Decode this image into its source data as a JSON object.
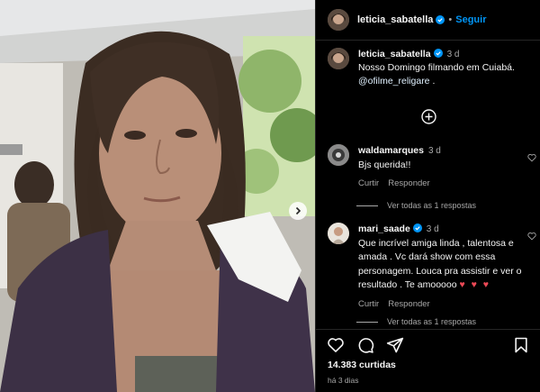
{
  "post": {
    "author": "leticia_sabatella",
    "follow_label": "Seguir",
    "separator": "•",
    "caption_author": "leticia_sabatella",
    "caption_time": "3 d",
    "caption_text": "Nosso Domingo filmando em Cuiabá.",
    "caption_mention": "@ofilme_religare",
    "caption_end": " ."
  },
  "comments": [
    {
      "user": "waldamarques",
      "time": "3 d",
      "text": "Bjs querida!!",
      "reply_label": "Curtir",
      "respond_label": "Responder",
      "view_replies": "Ver todas as 1 respostas"
    },
    {
      "user": "mari_saade",
      "time": "3 d",
      "text": "Que incrível amiga linda , talentosa e amada . Vc dará show com essa personagem. Louca pra assistir e ver o resultado . Te amooooo",
      "emoji": "♥ ♥ ♥",
      "reply_label": "Curtir",
      "respond_label": "Responder",
      "view_replies": "Ver todas as 1 respostas"
    }
  ],
  "footer": {
    "likes": "14.383 curtidas",
    "date": "há 3 dias"
  },
  "icons": {
    "verified": "verified-badge-icon",
    "load_more": "plus-circle-icon",
    "next": "chevron-right-icon",
    "like": "heart-icon",
    "comment": "comment-icon",
    "share": "share-icon",
    "save": "bookmark-icon"
  },
  "colors": {
    "background": "#000000",
    "link": "#0095f6",
    "secondary_text": "#a8a8a8",
    "heart": "#ed4956"
  }
}
